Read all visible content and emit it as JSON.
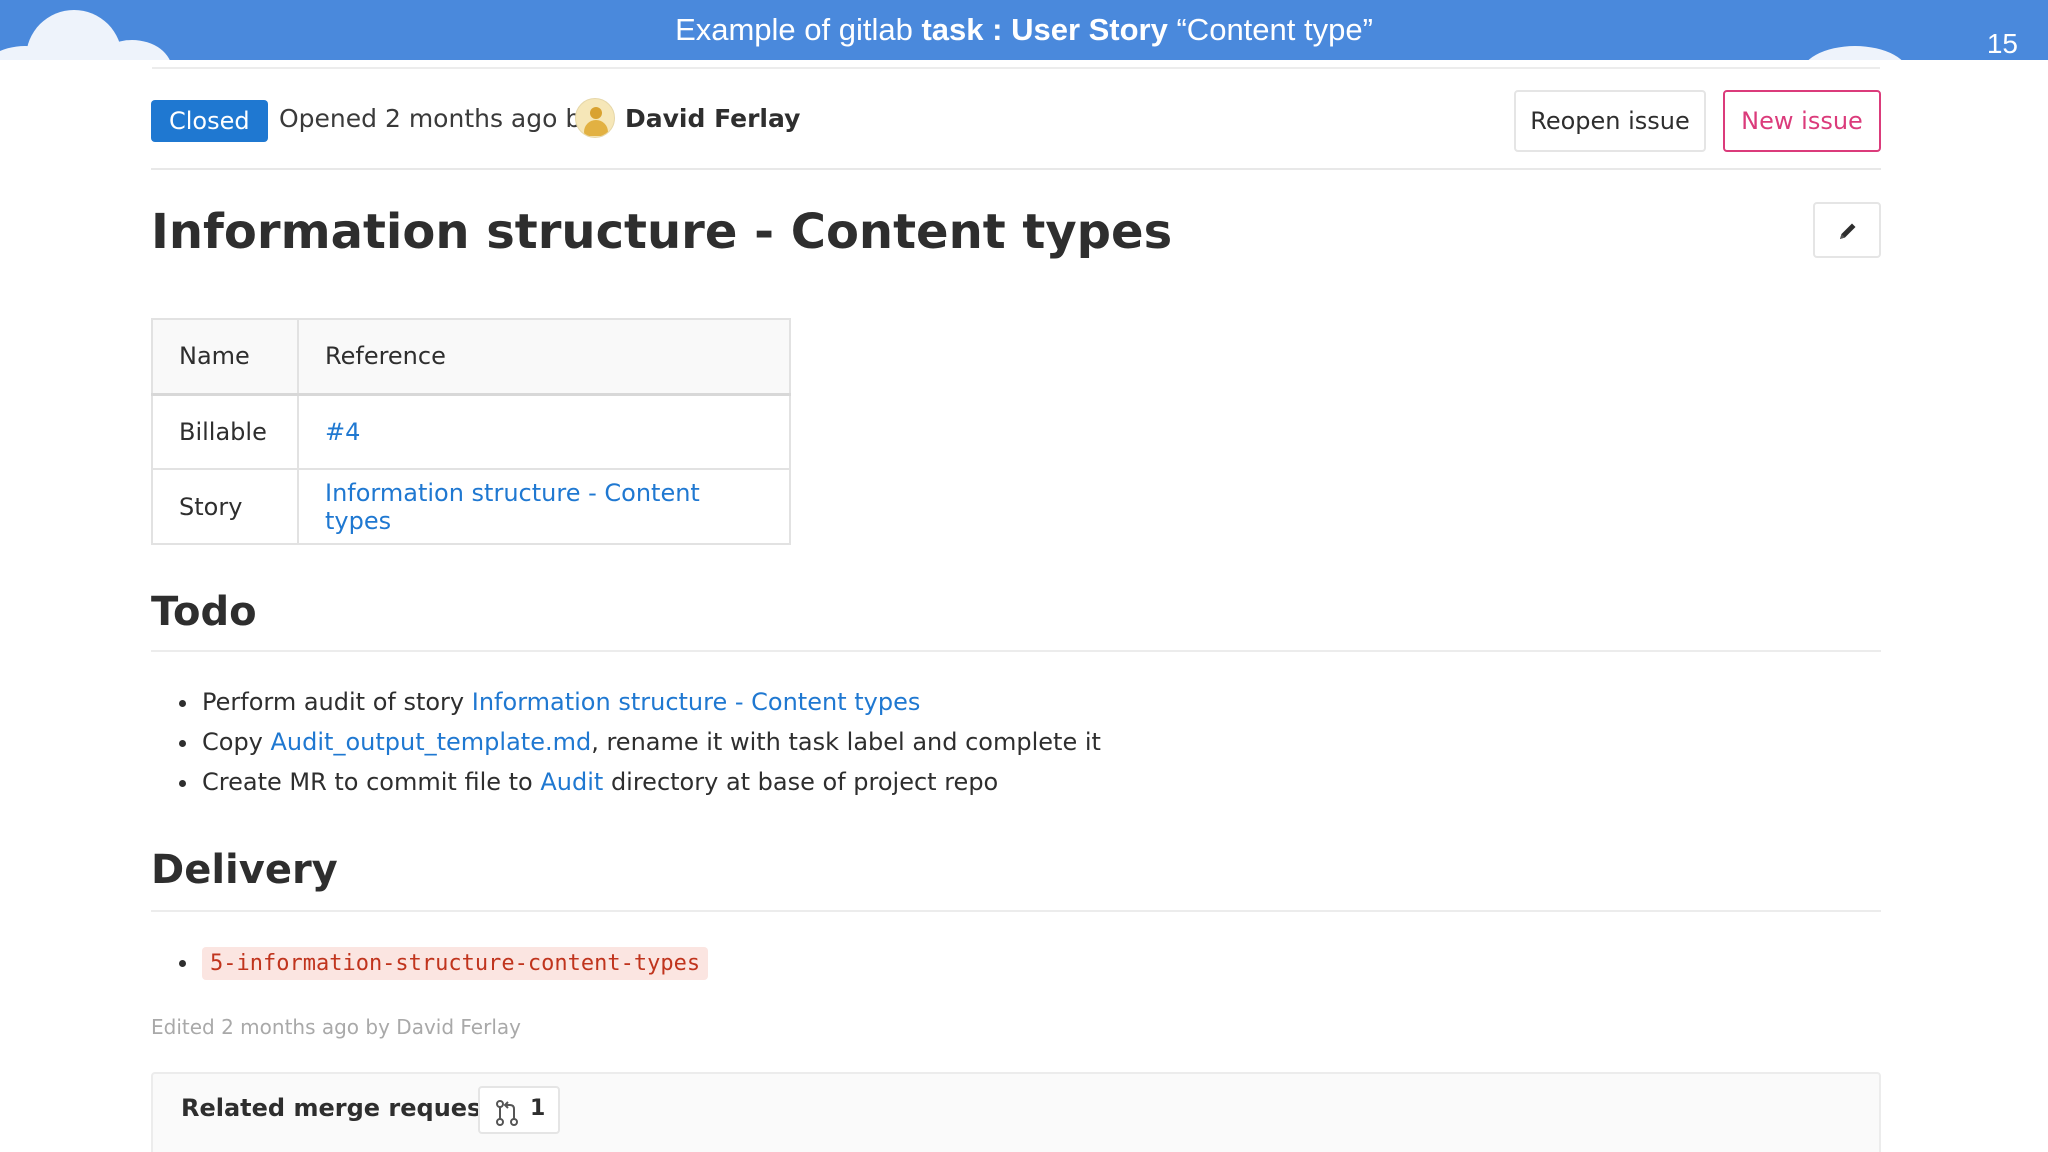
{
  "slide": {
    "title_prefix": "Example of gitlab ",
    "title_bold": "task : User Story",
    "title_suffix": " “Content type”",
    "page_number": "15"
  },
  "issue": {
    "status": "Closed",
    "opened_text": "Opened 2 months ago by",
    "author": "David Ferlay",
    "reopen_label": "Reopen issue",
    "new_issue_label": "New issue",
    "title": "Information structure - Content types"
  },
  "ref_table": {
    "headers": [
      "Name",
      "Reference"
    ],
    "rows": [
      {
        "name": "Billable",
        "reference": "#4"
      },
      {
        "name": "Story",
        "reference": "Information structure - Content types"
      }
    ]
  },
  "todo": {
    "heading": "Todo",
    "items": [
      {
        "before": "Perform audit of story ",
        "link": "Information structure - Content types",
        "after": ""
      },
      {
        "before": "Copy ",
        "link": "Audit_output_template.md",
        "after": ", rename it with task label and complete it"
      },
      {
        "before": "Create MR to commit file to ",
        "link": "Audit",
        "after": " directory at base of project repo"
      }
    ]
  },
  "delivery": {
    "heading": "Delivery",
    "branch": "5-information-structure-content-types"
  },
  "edited_note": "Edited 2 months ago by David Ferlay",
  "related": {
    "title": "Related merge requests",
    "count": "1"
  },
  "colors": {
    "header_band": "#4a89dc",
    "closed_badge": "#1f78d1",
    "new_issue_accent": "#db3b7b",
    "link": "#1f78d1",
    "code_text": "#c0341d"
  }
}
